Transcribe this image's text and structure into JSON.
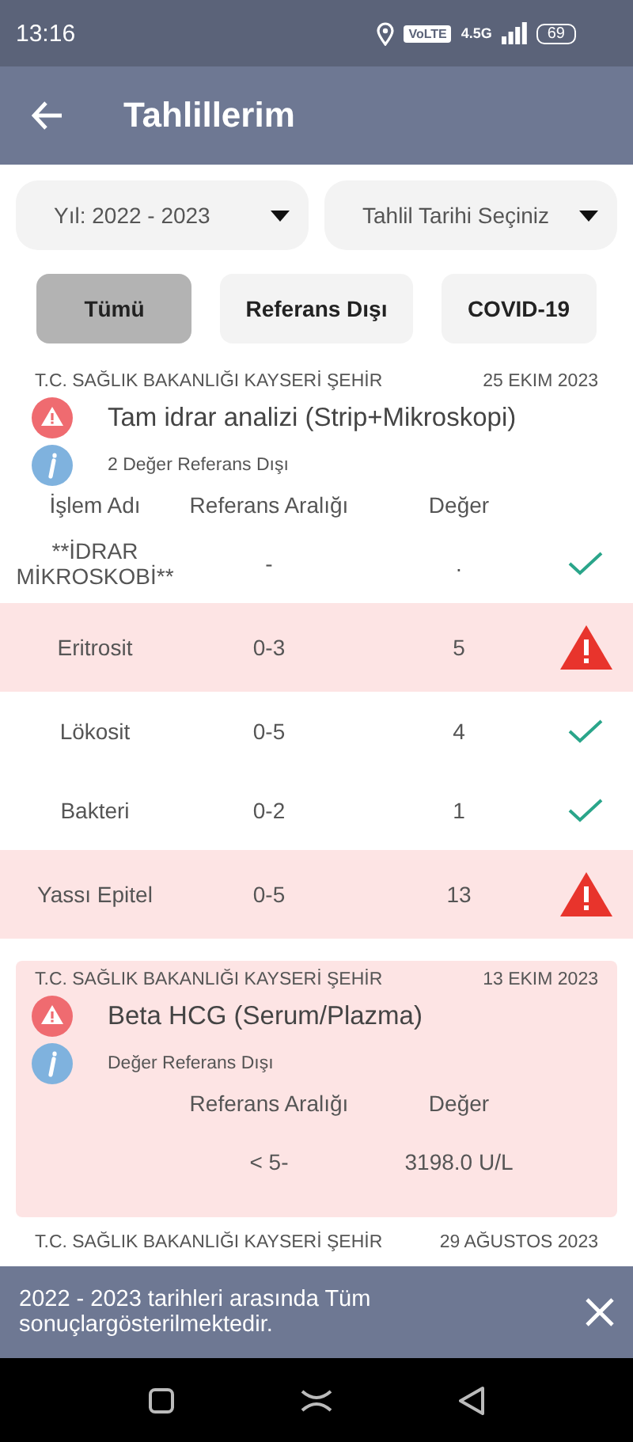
{
  "status_bar": {
    "time": "13:16",
    "volte": "VoLTE",
    "network": "4.5G",
    "battery": "69"
  },
  "app_bar": {
    "title": "Tahlillerim"
  },
  "filters": [
    {
      "label": "Yıl: 2022 - 2023"
    },
    {
      "label": "Tahlil Tarihi Seçiniz"
    }
  ],
  "chips": [
    {
      "label": "Tümü",
      "selected": true
    },
    {
      "label": "Referans Dışı",
      "selected": false
    },
    {
      "label": "COVID-19",
      "selected": false
    }
  ],
  "cards": [
    {
      "institution": "T.C. SAĞLIK BAKANLIĞI KAYSERİ ŞEHİR",
      "date": "25 EKIM 2023",
      "title": "Tam idrar analizi (Strip+Mikroskopi)",
      "note": "2 Değer Referans Dışı",
      "flagged": false,
      "columns": [
        "İşlem Adı",
        "Referans Aralığı",
        "Değer"
      ],
      "rows": [
        {
          "name": "**İDRAR MİKROSKOBİ**",
          "range": "-",
          "value": ".",
          "out_of_range": false
        },
        {
          "name": "Eritrosit",
          "range": "0-3",
          "value": "5",
          "out_of_range": true
        },
        {
          "name": "Lökosit",
          "range": "0-5",
          "value": "4",
          "out_of_range": false
        },
        {
          "name": "Bakteri",
          "range": "0-2",
          "value": "1",
          "out_of_range": false
        },
        {
          "name": "Yassı Epitel",
          "range": "0-5",
          "value": "13",
          "out_of_range": true
        }
      ]
    },
    {
      "institution": "T.C. SAĞLIK BAKANLIĞI KAYSERİ ŞEHİR",
      "date": "13 EKIM 2023",
      "title": "Beta HCG (Serum/Plazma)",
      "note": "Değer Referans Dışı",
      "flagged": true,
      "columns": [
        "Referans Aralığı",
        "Değer"
      ],
      "rows": [
        {
          "range": "< 5-",
          "value": "3198.0 U/L"
        }
      ]
    },
    {
      "institution": "T.C. SAĞLIK BAKANLIĞI KAYSERİ ŞEHİR",
      "date": "29 AĞUSTOS 2023"
    }
  ],
  "snackbar": {
    "message": "2022 - 2023 tarihleri arasında Tüm sonuçlargösterilmektedir."
  }
}
